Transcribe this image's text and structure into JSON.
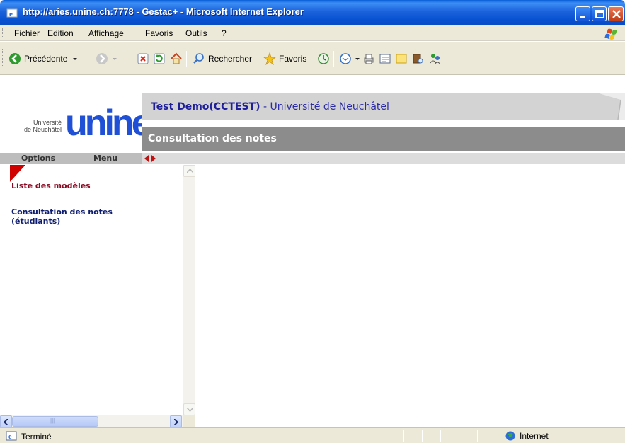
{
  "window": {
    "title": "http://aries.unine.ch:7778 - Gestac+ - Microsoft Internet Explorer"
  },
  "menubar": {
    "items": [
      "Fichier",
      "Edition",
      "Affichage",
      "Favoris",
      "Outils",
      "?"
    ]
  },
  "toolbar": {
    "back_label": "Précédente",
    "search_label": "Rechercher",
    "favorites_label": "Favoris"
  },
  "page": {
    "logo": {
      "small_line1": "Université",
      "small_line2": "de Neuchâtel",
      "big": "unine"
    },
    "header": {
      "user": "Test Demo(CCTEST)",
      "separator": " - ",
      "institution": "Université de Neuchâtel",
      "section_title": "Consultation des notes"
    },
    "options_bar": {
      "options_label": "Options",
      "menu_label": "Menu"
    },
    "side_menu": {
      "items": [
        "Liste des modèles",
        "Consultation des notes (étudiants)"
      ]
    }
  },
  "statusbar": {
    "text": "Terminé",
    "zone": "Internet"
  },
  "colors": {
    "titlebar_blue": "#0650d0",
    "link_active": "#8a0a24",
    "link_normal": "#0d1c6e",
    "header_text": "#2a2aa8",
    "logo_blue": "#1f50d6",
    "marker_red": "#d00000"
  }
}
